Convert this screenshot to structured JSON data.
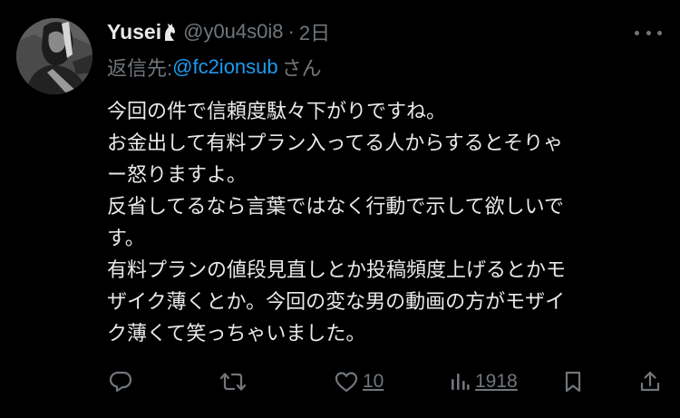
{
  "tweet": {
    "author": {
      "display_name": "Yusei",
      "name_icon": "horse-head-icon",
      "handle": "@y0u4s0i8",
      "separator": "·",
      "time": "2日"
    },
    "reply": {
      "prefix": "返信先: ",
      "target": "@fc2ionsub",
      "suffix": "さん"
    },
    "body_lines": [
      "今回の件で信頼度駄々下がりですね。",
      "お金出して有料プラン入ってる人からするとそりゃ",
      "ー怒りますよ。",
      "反省してるなら言葉ではなく行動で示して欲しいで",
      "す。",
      "有料プランの値段見直しとか投稿頻度上げるとかモ",
      "ザイク薄くとか。今回の変な男の動画の方がモザイ",
      "ク薄くて笑っちゃいました。"
    ],
    "actions": {
      "reply_icon": "speech-bubble-icon",
      "retweet_icon": "retweet-icon",
      "like_icon": "heart-icon",
      "like_count": "10",
      "views_icon": "bar-chart-icon",
      "views_count": "1918",
      "bookmark_icon": "bookmark-icon",
      "share_icon": "share-icon"
    },
    "more_icon": "more-dots-icon"
  },
  "colors": {
    "background": "#000000",
    "text": "#e7e9ea",
    "muted": "#71767b",
    "link": "#1d9bf0"
  }
}
